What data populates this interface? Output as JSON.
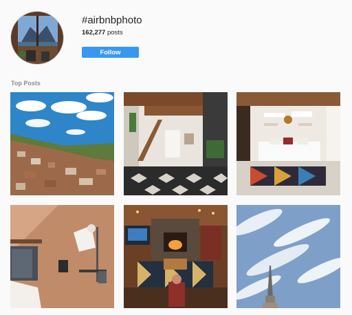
{
  "profile": {
    "hashtag": "#airbnbphoto",
    "post_count": "162,277",
    "post_label": "posts",
    "follow_label": "Follow",
    "avatar_icon": "window-lake-view-photo"
  },
  "section": {
    "title": "Top Posts"
  },
  "colors": {
    "follow_blue": "#3897f0",
    "muted": "#8e8e8e",
    "text": "#262626",
    "bg": "#fafafa"
  },
  "posts": [
    {
      "icon": "hillside-town-photo"
    },
    {
      "icon": "loft-interior-photo"
    },
    {
      "icon": "white-bedroom-photo"
    },
    {
      "icon": "wall-lamp-photo"
    },
    {
      "icon": "cozy-cabin-fireplace-photo"
    },
    {
      "icon": "cloudy-sky-spire-photo"
    }
  ]
}
